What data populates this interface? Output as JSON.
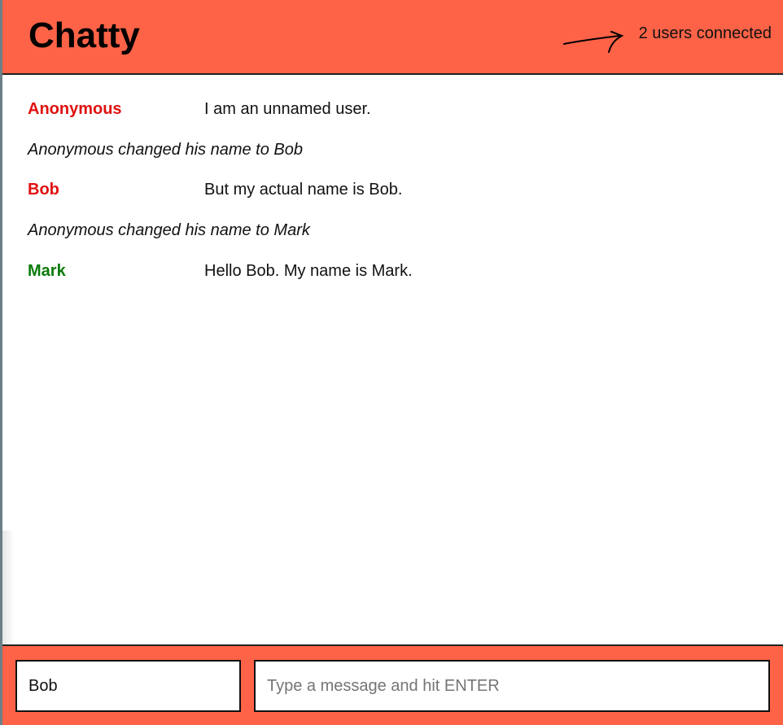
{
  "header": {
    "title": "Chatty",
    "users_connected": "2 users connected"
  },
  "messages": [
    {
      "type": "message",
      "username": "Anonymous",
      "text": "I am an unnamed user.",
      "color": "#e01010"
    },
    {
      "type": "notification",
      "text": "Anonymous changed his name to Bob"
    },
    {
      "type": "message",
      "username": "Bob",
      "text": "But my actual name is Bob.",
      "color": "#e01010"
    },
    {
      "type": "notification",
      "text": "Anonymous changed his name to Mark"
    },
    {
      "type": "message",
      "username": "Mark",
      "text": "Hello Bob. My name is Mark.",
      "color": "#0a7a0a"
    }
  ],
  "composer": {
    "username_value": "Bob",
    "message_placeholder": "Type a message and hit ENTER"
  },
  "colors": {
    "accent": "#ff6347",
    "username_red": "#e01010",
    "username_green": "#0a7a0a"
  },
  "icons": {
    "annotation": "hand-drawn-arrow-icon"
  }
}
